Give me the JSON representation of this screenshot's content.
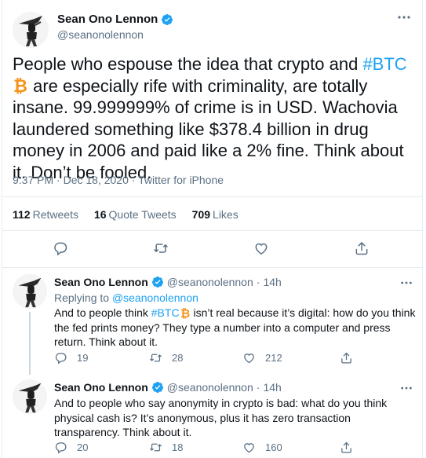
{
  "main_tweet": {
    "author_name": "Sean Ono Lennon",
    "handle": "@seanonolennon",
    "text_part1": "People who espouse the idea that crypto and ",
    "hashtag": "#BTC",
    "text_part2": " are especially rife with criminality, are totally insane. 99.999999% of crime is in USD. Wachovia laundered something like $378.4 billion in drug money in 2006 and paid like a 2% fine. Think about it. Don’t be fooled.",
    "time": "9:37 PM",
    "date": "Dec 18, 2020",
    "source": "Twitter for iPhone",
    "retweets_count": "112",
    "retweets_label": "Retweets",
    "quote_count": "16",
    "quote_label": "Quote Tweets",
    "likes_count": "709",
    "likes_label": "Likes"
  },
  "replies": [
    {
      "author_name": "Sean Ono Lennon",
      "handle": "@seanonolennon",
      "age": "14h",
      "replying_prefix": "Replying to ",
      "replying_to": "@seanonolennon",
      "text_part1": "And to people think ",
      "hashtag": "#BTC",
      "text_part2": " isn’t real because it’s digital: how do you think the fed prints money? They type a number into a computer and press return. Think about it.",
      "reply_count": "19",
      "retweet_count": "28",
      "like_count": "212"
    },
    {
      "author_name": "Sean Ono Lennon",
      "handle": "@seanonolennon",
      "age": "14h",
      "text": "And to people who say anonymity in crypto is bad: what do you think physical cash is? It’s anonymous, plus it has zero transaction transparency. Think about it.",
      "reply_count": "20",
      "retweet_count": "18",
      "like_count": "160"
    }
  ],
  "separator": " · ",
  "colors": {
    "accent": "#1da1f2",
    "bitcoin": "#f7931a",
    "muted": "#5b7083",
    "border": "#e6ecf0"
  },
  "icons": [
    "verified-badge-icon",
    "more-icon",
    "reply-icon",
    "retweet-icon",
    "like-icon",
    "share-icon",
    "bitcoin-icon"
  ]
}
